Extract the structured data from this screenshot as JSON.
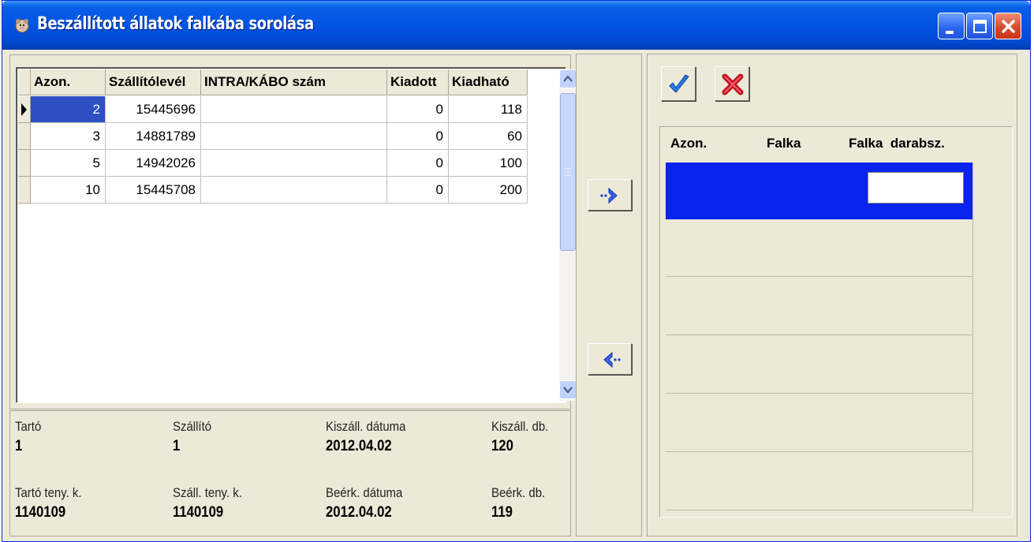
{
  "window": {
    "title": "Beszállított állatok falkába sorolása"
  },
  "grid": {
    "columns": [
      "Azon.",
      "Szállítólevél",
      "INTRA/KÁBO szám",
      "Kiadott",
      "Kiadható"
    ],
    "rows": [
      [
        "2",
        "15445696",
        "",
        "0",
        "118"
      ],
      [
        "3",
        "14881789",
        "",
        "0",
        "60"
      ],
      [
        "5",
        "14942026",
        "",
        "0",
        "100"
      ],
      [
        "10",
        "15445708",
        "",
        "0",
        "200"
      ]
    ]
  },
  "info": {
    "tarto_label": "Tartó",
    "tarto_value": "1",
    "szallito_label": "Szállító",
    "szallito_value": "1",
    "kiszall_datum_label": "Kiszáll. dátuma",
    "kiszall_datum_value": "2012.04.02",
    "kiszall_db_label": "Kiszáll. db.",
    "kiszall_db_value": "120",
    "tarto_teny_label": "Tartó teny. k.",
    "tarto_teny_value": "1140109",
    "szall_teny_label": "Száll. teny. k.",
    "szall_teny_value": "1140109",
    "beerk_datum_label": "Beérk. dátuma",
    "beerk_datum_value": "2012.04.02",
    "beerk_db_label": "Beérk. db.",
    "beerk_db_value": "119"
  },
  "falka_grid": {
    "columns": [
      "Azon.",
      "Falka",
      "Falka  darabsz."
    ]
  },
  "icons": {
    "move_right": "arrow-right-icon",
    "move_left": "arrow-left-icon",
    "ok": "checkmark-icon",
    "cancel": "red-x-icon"
  },
  "colors": {
    "titlebar": "#0054e3",
    "selection": "#0a24ee",
    "face": "#ece9d8"
  }
}
